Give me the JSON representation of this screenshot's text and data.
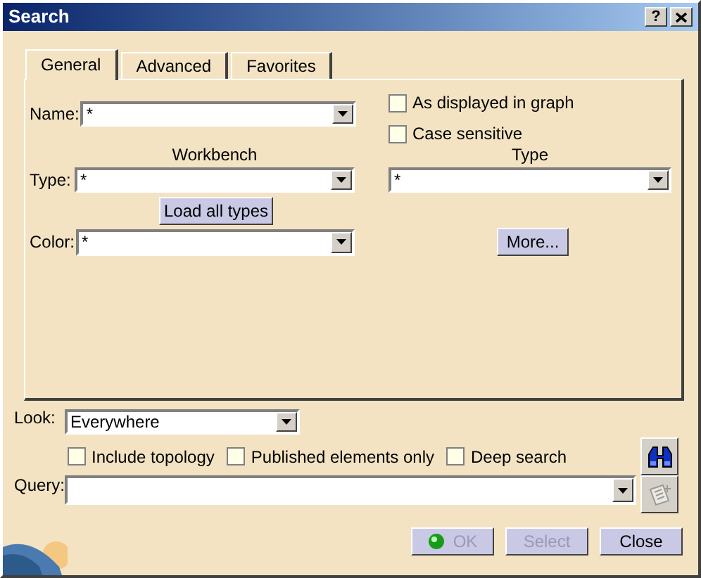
{
  "window": {
    "title": "Search",
    "help_button": "?"
  },
  "tabs": [
    {
      "label": "General",
      "selected": true
    },
    {
      "label": "Advanced",
      "selected": false
    },
    {
      "label": "Favorites",
      "selected": false
    }
  ],
  "general": {
    "name": {
      "label": "Name:",
      "value": "*"
    },
    "options": [
      {
        "label": "As displayed in graph",
        "checked": false
      },
      {
        "label": "Case sensitive",
        "checked": false
      }
    ],
    "workbench_heading": "Workbench",
    "type_heading": "Type",
    "type": {
      "label": "Type:",
      "value": "*"
    },
    "type_right": {
      "value": "*"
    },
    "load_button": "Load all types",
    "color": {
      "label": "Color:",
      "value": "*"
    },
    "more_button": "More..."
  },
  "look": {
    "label": "Look:",
    "value": "Everywhere"
  },
  "scope_options": [
    {
      "label": "Include topology",
      "checked": false
    },
    {
      "label": "Published elements only",
      "checked": false
    },
    {
      "label": "Deep search",
      "checked": false
    }
  ],
  "query": {
    "label": "Query:",
    "add_disabled": true
  },
  "buttons": [
    {
      "label": "OK",
      "disabled": true,
      "kind": "ok"
    },
    {
      "label": "Select",
      "disabled": true,
      "kind": "plain"
    },
    {
      "label": "Close",
      "disabled": false,
      "kind": "plain"
    }
  ]
}
